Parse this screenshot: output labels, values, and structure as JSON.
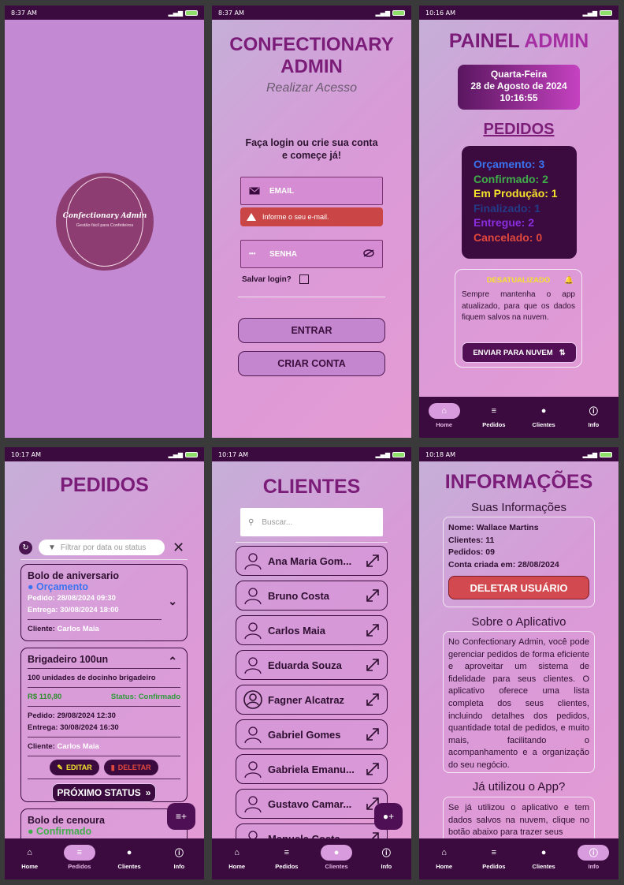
{
  "status": {
    "s1": "8:37 AM",
    "s2": "8:37 AM",
    "s3": "10:16 AM",
    "s4": "10:17 AM",
    "s5": "10:17 AM",
    "s6": "10:18 AM"
  },
  "splash": {
    "logo_title": "Confectionary Admin",
    "logo_subtitle": "Gestão fácil para Confeiteiros"
  },
  "login": {
    "title": "CONFECTIONARY ADMIN",
    "subtitle": "Realizar Acesso",
    "message": "Faça login ou crie sua conta e começe já!",
    "email_label": "EMAIL",
    "email_error": "Informe o seu e-mail.",
    "password_label": "SENHA",
    "save_label": "Salvar login?",
    "enter_label": "ENTRAR",
    "create_label": "CRIAR CONTA"
  },
  "admin": {
    "title_a": "PAINEL",
    "title_b": "ADMIN",
    "weekday": "Quarta-Feira",
    "date": "28 de Agosto de 2024",
    "time": "10:16:55",
    "orders_heading": "PEDIDOS",
    "statuses": [
      {
        "label": "Orçamento: 3",
        "color": "#3a73f0"
      },
      {
        "label": "Confirmado: 2",
        "color": "#3fae4a"
      },
      {
        "label": "Em Produção: 1",
        "color": "#f5e22a"
      },
      {
        "label": "Finalizado: 1",
        "color": "#243a86"
      },
      {
        "label": "Entregue: 2",
        "color": "#8a2ee0"
      },
      {
        "label": "Cancelado: 0",
        "color": "#e0483d"
      }
    ],
    "warning_title": "DESATUALIZADO",
    "warning_text": "Sempre mantenha o app atualizado, para que os dados fiquem salvos na nuvem.",
    "cloud_button": "ENVIAR PARA NUVEM"
  },
  "nav": {
    "home": "Home",
    "orders": "Pedidos",
    "clients": "Clientes",
    "info": "Info"
  },
  "orders": {
    "title": "PEDIDOS",
    "filter_placeholder": "Filtrar por data ou status",
    "card1": {
      "title": "Bolo de aniversario",
      "status": "Orçamento",
      "pedido": "Pedido: 28/08/2024 09:30",
      "entrega": "Entrega: 30/08/2024 18:00",
      "cliente_label": "Cliente:",
      "cliente": "Carlos Maia"
    },
    "card2": {
      "title": "Brigadeiro 100un",
      "desc": "100 unidades de docinho brigadeiro",
      "price": "R$ 110,80",
      "status": "Status: Confirmado",
      "pedido": "Pedido: 29/08/2024 12:30",
      "entrega": "Entrega: 30/08/2024 16:30",
      "cliente_label": "Cliente:",
      "cliente": "Carlos Maia",
      "edit": "EDITAR",
      "delete": "DELETAR",
      "next": "PRÓXIMO STATUS"
    },
    "card3": {
      "title": "Bolo de cenoura",
      "status": "Confirmado"
    }
  },
  "clients": {
    "title": "CLIENTES",
    "search_placeholder": "Buscar...",
    "items": [
      "Ana Maria Gom...",
      "Bruno Costa",
      "Carlos Maia",
      "Eduarda Souza",
      "Fagner Alcatraz",
      "Gabriel Gomes",
      "Gabriela Emanu...",
      "Gustavo Camar...",
      "Manuela Costa"
    ]
  },
  "info": {
    "title": "INFORMAÇÕES",
    "your_info": "Suas Informações",
    "name": "Nome: Wallace Martins",
    "clients": "Clientes: 11",
    "orders": "Pedidos: 09",
    "created": "Conta criada em: 28/08/2024",
    "delete_user": "DELETAR USUÁRIO",
    "about_title": "Sobre o Aplicativo",
    "about_text": "No Confectionary Admin, você pode gerenciar pedidos de forma eficiente e aproveitar um sistema de fidelidade para seus clientes. O aplicativo oferece uma lista completa dos seus clientes, incluindo detalhes dos pedidos, quantidade total de pedidos, e muito mais, facilitando o acompanhamento e a organização do seu negócio.",
    "used_title": "Já utilizou o App?",
    "used_text": "Se já utilizou o aplicativo e tem dados salvos na nuvem, clique no botão abaixo para trazer seus"
  }
}
